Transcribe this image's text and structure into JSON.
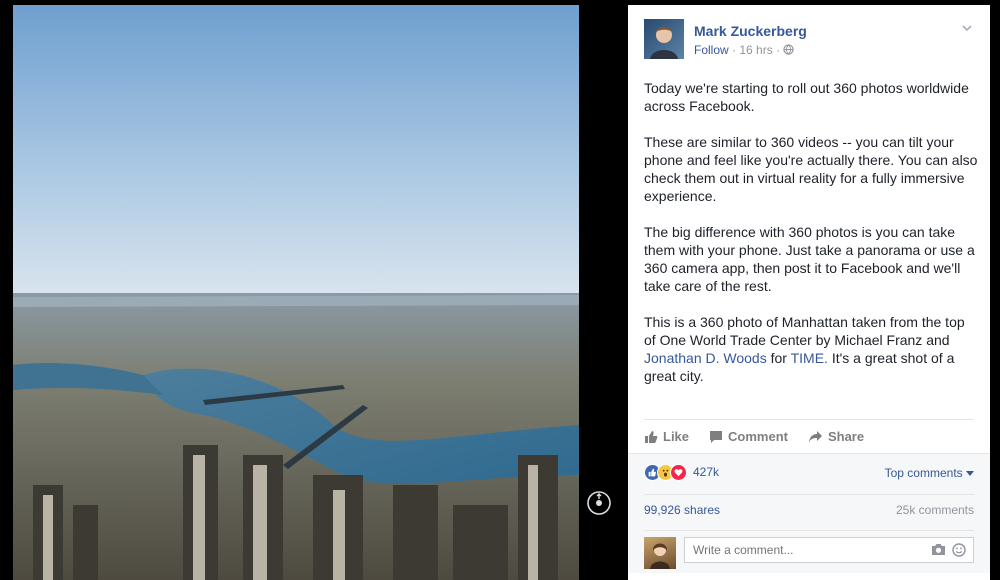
{
  "post": {
    "author": "Mark Zuckerberg",
    "follow_label": "Follow",
    "time": "16 hrs",
    "paragraphs": [
      "Today we're starting to roll out 360 photos worldwide across Facebook.",
      "These are similar to 360 videos -- you can tilt your phone and feel like you're actually there. You can also check them out in virtual reality for a fully immersive experience.",
      "The big difference with 360 photos is you can take them with your phone. Just take a panorama or use a 360 camera app, then post it to Facebook and we'll take care of the rest."
    ],
    "last_paragraph": {
      "text_1": "This is a 360 photo of Manhattan taken from the top of One World Trade Center by Michael Franz and",
      "link_1": "Jonathan D. Woods",
      "text_2": "for",
      "link_2": "TIME.",
      "text_3": "It's a great shot of a great city."
    }
  },
  "actions": {
    "like": "Like",
    "comment": "Comment",
    "share": "Share"
  },
  "stats": {
    "reaction_count": "427k",
    "top_comments_label": "Top comments",
    "shares": "99,926 shares",
    "comments": "25k comments"
  },
  "composer": {
    "placeholder": "Write a comment..."
  },
  "colors": {
    "link": "#365899",
    "like_blue": "#4267b2",
    "love_red": "#f0284a",
    "wow_yellow": "#f7c744"
  },
  "icons": [
    "chevron-down-icon",
    "globe-icon",
    "like-icon",
    "comment-icon",
    "share-icon",
    "camera-icon",
    "emoji-icon",
    "360-icon"
  ]
}
